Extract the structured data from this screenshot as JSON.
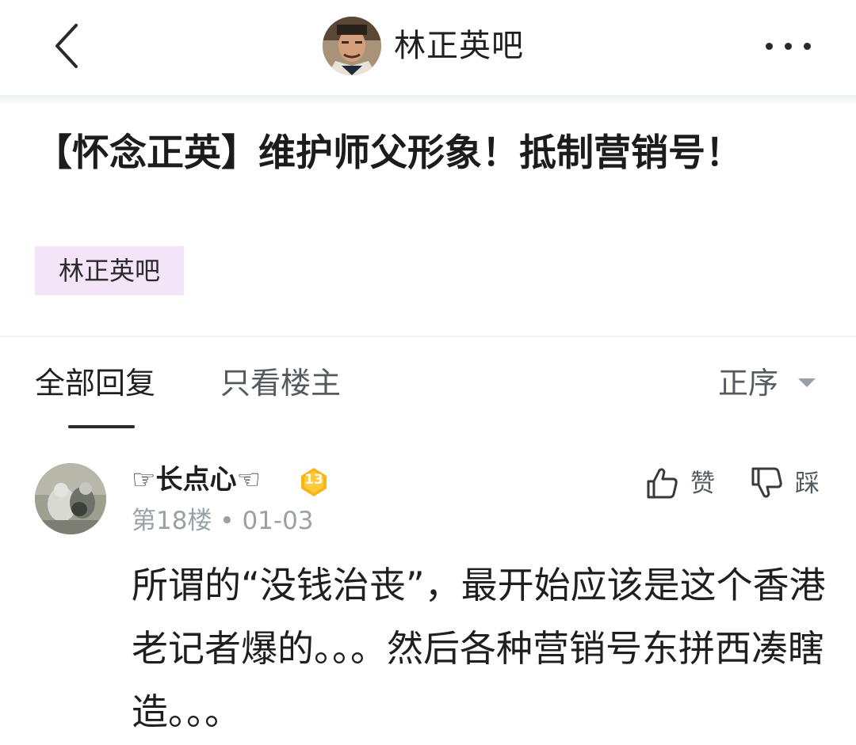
{
  "header": {
    "title": "林正英吧",
    "back_icon": "chevron-left-icon",
    "more_icon": "more-horizontal-icon"
  },
  "post": {
    "title": "【怀念正英】维护师父形象！抵制营销号！",
    "tag": "林正英吧"
  },
  "tabs": {
    "all": "全部回复",
    "op_only": "只看楼主",
    "sort": "正序"
  },
  "reply": {
    "username": "☞长点心☜",
    "level": "13",
    "meta": "第18楼 • 01-03",
    "like_label": "赞",
    "dislike_label": "踩",
    "content": "所谓的“没钱治丧”，最开始应该是这个香港老记者爆的。。。然后各种营销号东拼西凑瞎造。。。"
  },
  "colors": {
    "tag_bg": "#f3e4f8",
    "badge": "#f7b519",
    "meta_text": "#9aa0a6"
  }
}
